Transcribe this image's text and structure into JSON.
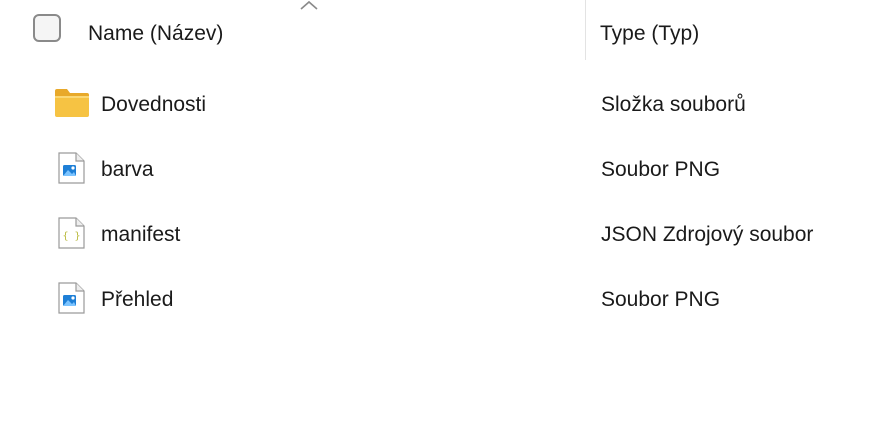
{
  "header": {
    "select_all_label": "",
    "name_column": "Name (Název)",
    "type_column": "Type (Typ)"
  },
  "files": [
    {
      "name": "Dovednosti",
      "type": "Složka souborů",
      "icon": "folder-icon"
    },
    {
      "name": "barva",
      "type": "Soubor PNG",
      "icon": "png-file-icon"
    },
    {
      "name": "manifest",
      "type": "JSON Zdrojový soubor",
      "icon": "json-file-icon"
    },
    {
      "name": "Přehled",
      "type": "Soubor PNG",
      "icon": "png-file-icon"
    }
  ],
  "colors": {
    "folder": "#f6c343",
    "folder_dark": "#e8a92a",
    "image_accent": "#1e7fd6",
    "json_accent": "#b9b93c"
  }
}
